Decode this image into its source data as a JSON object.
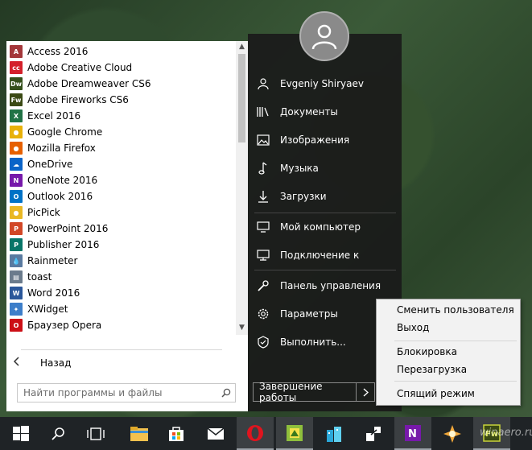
{
  "start_menu": {
    "apps": [
      {
        "label": "Access 2016",
        "icon": "access-icon",
        "color": "#a4373a",
        "glyph": "A"
      },
      {
        "label": "Adobe Creative Cloud",
        "icon": "creative-cloud-icon",
        "color": "#d4202b",
        "glyph": "cc"
      },
      {
        "label": "Adobe Dreamweaver CS6",
        "icon": "dreamweaver-icon",
        "color": "#35501c",
        "glyph": "Dw"
      },
      {
        "label": "Adobe Fireworks CS6",
        "icon": "fireworks-icon",
        "color": "#3b4a14",
        "glyph": "Fw"
      },
      {
        "label": "Excel 2016",
        "icon": "excel-icon",
        "color": "#217346",
        "glyph": "X"
      },
      {
        "label": "Google Chrome",
        "icon": "chrome-icon",
        "color": "#e8b10a",
        "glyph": "●"
      },
      {
        "label": "Mozilla Firefox",
        "icon": "firefox-icon",
        "color": "#e66000",
        "glyph": "●"
      },
      {
        "label": "OneDrive",
        "icon": "onedrive-icon",
        "color": "#0a64c8",
        "glyph": "☁"
      },
      {
        "label": "OneNote 2016",
        "icon": "onenote-icon",
        "color": "#7719aa",
        "glyph": "N"
      },
      {
        "label": "Outlook 2016",
        "icon": "outlook-icon",
        "color": "#0072c6",
        "glyph": "O"
      },
      {
        "label": "PicPick",
        "icon": "picpick-icon",
        "color": "#e9b825",
        "glyph": "●"
      },
      {
        "label": "PowerPoint 2016",
        "icon": "powerpoint-icon",
        "color": "#d24726",
        "glyph": "P"
      },
      {
        "label": "Publisher 2016",
        "icon": "publisher-icon",
        "color": "#077568",
        "glyph": "P"
      },
      {
        "label": "Rainmeter",
        "icon": "rainmeter-icon",
        "color": "#5a7aa0",
        "glyph": "💧"
      },
      {
        "label": "toast",
        "icon": "toast-icon",
        "color": "#6b7b8c",
        "glyph": "▤"
      },
      {
        "label": "Word 2016",
        "icon": "word-icon",
        "color": "#2b579a",
        "glyph": "W"
      },
      {
        "label": "XWidget",
        "icon": "xwidget-icon",
        "color": "#3d7ec9",
        "glyph": "✦"
      },
      {
        "label": "Браузер Opera",
        "icon": "opera-icon",
        "color": "#cc0f16",
        "glyph": "O"
      }
    ],
    "back_label": "Назад",
    "search_placeholder": "Найти программы и файлы"
  },
  "right_panel": {
    "user_name": "Evgeniy Shiryaev",
    "places": [
      {
        "label": "Документы",
        "icon": "documents-icon"
      },
      {
        "label": "Изображения",
        "icon": "pictures-icon"
      },
      {
        "label": "Музыка",
        "icon": "music-icon"
      },
      {
        "label": "Загрузки",
        "icon": "downloads-icon"
      },
      {
        "label": "Мой компьютер",
        "icon": "computer-icon"
      },
      {
        "label": "Подключение к",
        "icon": "connect-icon"
      },
      {
        "label": "Панель управления",
        "icon": "control-panel-icon"
      },
      {
        "label": "Параметры",
        "icon": "settings-gear-icon"
      },
      {
        "label": "Выполнить...",
        "icon": "run-icon"
      }
    ],
    "shutdown_label": "Завершение работы"
  },
  "context_menu": {
    "items": [
      "Сменить пользователя",
      "Выход",
      "Блокировка",
      "Перезагрузка",
      "Спящий режим"
    ]
  },
  "taskbar": {
    "items": [
      "start-windows-icon",
      "search-icon",
      "task-view-icon",
      "file-explorer-icon",
      "store-icon",
      "mail-icon",
      "opera-icon",
      "greenshot-icon",
      "buildings-icon",
      "share-icon",
      "onenote-icon",
      "xnview-icon",
      "fireworks-icon"
    ]
  },
  "watermark": "winaero.ru"
}
